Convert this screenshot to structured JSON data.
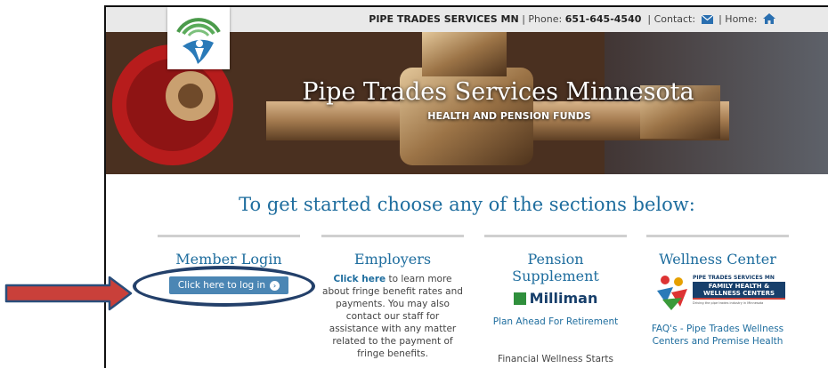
{
  "topbar": {
    "org": "PIPE TRADES SERVICES MN",
    "phone_label": "| Phone:",
    "phone": "651-645-4540",
    "contact_label": "| Contact:",
    "home_label": "| Home:"
  },
  "hero": {
    "title": "Pipe Trades Services Minnesota",
    "subtitle": "HEALTH AND PENSION FUNDS"
  },
  "headline": "To get started choose any of the sections below:",
  "member": {
    "title": "Member Login",
    "button": "Click here to log in"
  },
  "employers": {
    "title": "Employers",
    "link": "Click here",
    "text": "to learn more about fringe benefit rates and payments. You may also contact our staff for assistance with any matter related to the payment of fringe benefits."
  },
  "pension": {
    "title": "Pension Supplement",
    "logo": "Milliman",
    "link1": "Plan Ahead For Retirement",
    "link2": "Financial Wellness Starts"
  },
  "wellness": {
    "title": "Wellness Center",
    "logo_line1": "PIPE TRADES SERVICES MN",
    "logo_line2": "FAMILY HEALTH &",
    "logo_line3": "WELLNESS CENTERS",
    "logo_tagline": "Driving the pipe trades industry in Minnesota",
    "link": "FAQ's - Pipe Trades Wellness Centers and Premise Health"
  },
  "colors": {
    "accent": "#1e6d9e",
    "button": "#4b86b4",
    "annotation_oval": "#23406a",
    "annotation_arrow": "#c9403a"
  }
}
